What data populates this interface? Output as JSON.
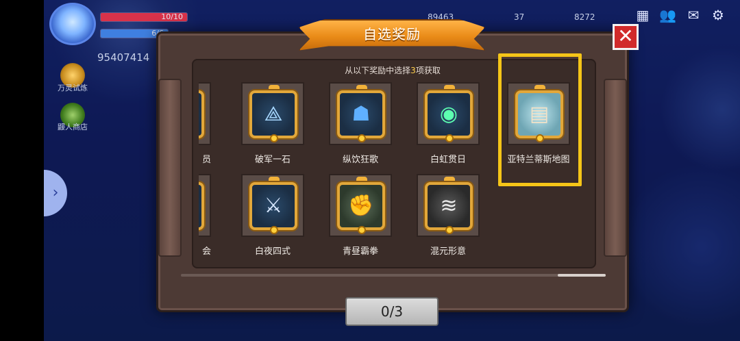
{
  "hud": {
    "hp": "10/10",
    "mp": "6/6",
    "player_id": "95407414",
    "currency_1": "89463",
    "currency_2": "37",
    "currency_3": "8272",
    "side_menu": [
      {
        "label": "万灵试炼"
      },
      {
        "label": "鼹人商店"
      }
    ]
  },
  "dialog": {
    "title": "自选奖励",
    "subtitle_prefix": "从以下奖励中选择",
    "subtitle_count": "3",
    "subtitle_suffix": "项获取",
    "close_icon": "close-icon",
    "confirm_label": "0/3"
  },
  "rewards": {
    "row1_partial_label": "员",
    "row2_partial_label": "会",
    "row1": [
      {
        "label": "破军一石",
        "icon": "rune-sigil-icon"
      },
      {
        "label": "纵饮狂歌",
        "icon": "dark-warrior-icon"
      },
      {
        "label": "白虹贯日",
        "icon": "green-orb-icon"
      },
      {
        "label": "亚特兰蒂斯地图",
        "icon": "map-scroll-icon"
      }
    ],
    "row2": [
      {
        "label": "白夜四式",
        "icon": "sword-emblem-icon"
      },
      {
        "label": "青昼霸拳",
        "icon": "lion-fist-icon"
      },
      {
        "label": "混元形意",
        "icon": "claw-strike-icon"
      }
    ]
  },
  "colors": {
    "highlight": "#f5c518",
    "banner": "#e98a17",
    "close": "#d12a2a"
  }
}
